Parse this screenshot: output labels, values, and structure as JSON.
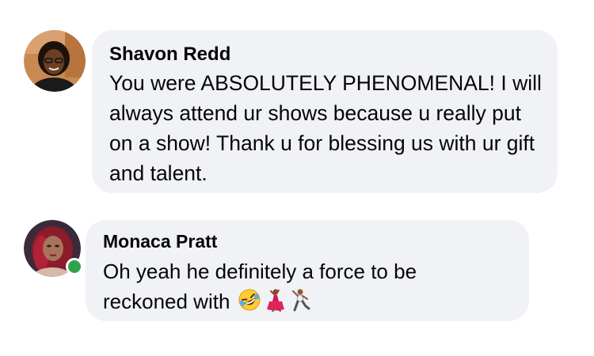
{
  "comments": [
    {
      "author": "Shavon Redd",
      "text": "You were ABSOLUTELY PHENOMENAL! I will always attend ur shows because u really put on a show! Thank u for blessing us with ur gift and talent.",
      "online": false
    },
    {
      "author": "Monaca Pratt",
      "text": "Oh yeah he definitely a force to be reckoned with",
      "emojis": [
        "rolling-on-floor-laughing",
        "woman-dancing",
        "man-dancing"
      ],
      "online": true
    }
  ],
  "colors": {
    "bubble": "#f0f2f5",
    "text": "#050505",
    "online": "#31a24c"
  }
}
